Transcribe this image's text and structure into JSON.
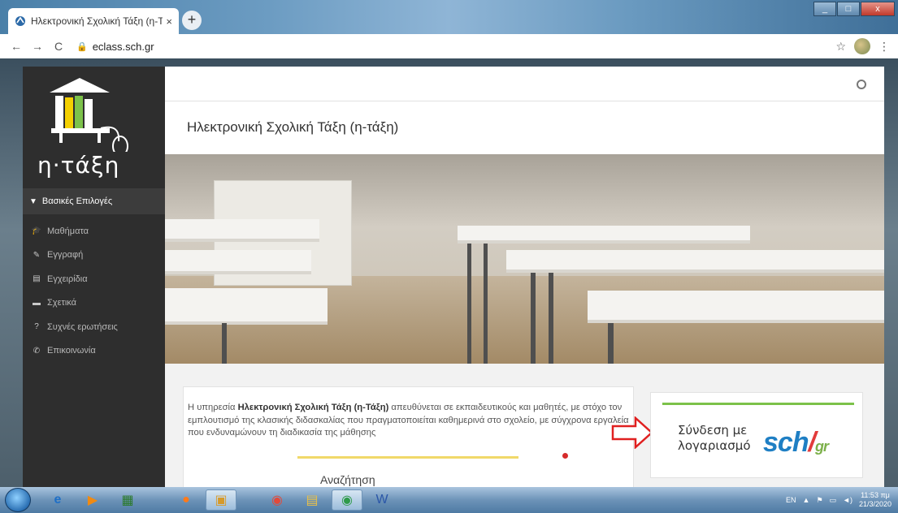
{
  "browser": {
    "tab_title": "Ηλεκτρονική Σχολική Τάξη (η-Τά",
    "tab_close": "×",
    "new_tab": "+",
    "url": "eclass.sch.gr",
    "back": "←",
    "forward": "→",
    "reload": "C",
    "bookmark": "☆",
    "menu": "⋮"
  },
  "sidebar": {
    "logo_text": "η·τάξη",
    "section_title": "Βασικές Επιλογές",
    "items": [
      {
        "label": "Μαθήματα",
        "icon": "graduation-cap-icon",
        "glyph": "🎓"
      },
      {
        "label": "Εγγραφή",
        "icon": "edit-icon",
        "glyph": "✎"
      },
      {
        "label": "Εγχειρίδια",
        "icon": "file-icon",
        "glyph": "▤"
      },
      {
        "label": "Σχετικά",
        "icon": "card-icon",
        "glyph": "▬"
      },
      {
        "label": "Συχνές ερωτήσεις",
        "icon": "question-icon",
        "glyph": "?"
      },
      {
        "label": "Επικοινωνία",
        "icon": "phone-icon",
        "glyph": "✆"
      }
    ]
  },
  "main": {
    "page_title": "Ηλεκτρονική Σχολική Τάξη (η-τάξη)",
    "intro_prefix": "Η υπηρεσία ",
    "intro_bold": "Ηλεκτρονική Σχολική Τάξη (η-Τάξη)",
    "intro_rest": " απευθύνεται σε εκπαιδευτικούς και μαθητές, με στόχο τον εμπλουτισμό της κλασικής διδασκαλίας που πραγματοποιείται καθημερινά στο σχολείο, με σύγχρονα εργαλεία που ενδυναμώνουν τη διαδικασία της μάθησης",
    "search_partial": "Αναζήτηση"
  },
  "login": {
    "line1": "Σύνδεση με",
    "line2": "λογαριασμό",
    "brand_sch": "sch",
    "brand_slash": "/",
    "brand_gr": "gr"
  },
  "taskbar": {
    "lang": "EN",
    "time": "11:53 πμ",
    "date": "21/3/2020"
  },
  "colors": {
    "sidebar_bg": "#2e2e2e",
    "login_accent": "#7cc24a",
    "intro_accent": "#f1d96a",
    "sch_blue": "#1f7fc4",
    "arrow_red": "#e02020"
  }
}
